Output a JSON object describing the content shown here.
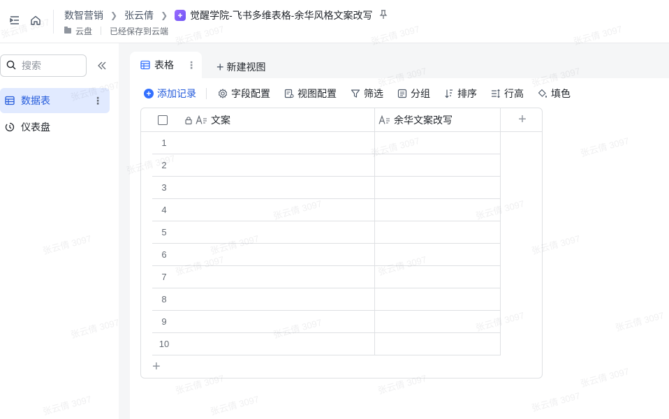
{
  "header": {
    "breadcrumbs": [
      "数智营销",
      "张云倩"
    ],
    "doc_title": "觉醒学院-飞书多维表格-余华风格文案改写",
    "location": "云盘",
    "save_status": "已经保存到云端"
  },
  "sidebar": {
    "search_placeholder": "搜索",
    "items": [
      {
        "label": "数据表",
        "icon": "table-icon",
        "active": true
      },
      {
        "label": "仪表盘",
        "icon": "dashboard-icon",
        "active": false
      }
    ]
  },
  "tabs": {
    "active_label": "表格",
    "new_view_label": "新建视图"
  },
  "toolbar": {
    "add_record": "添加记录",
    "field_config": "字段配置",
    "view_config": "视图配置",
    "filter": "筛选",
    "group": "分组",
    "sort": "排序",
    "row_height": "行高",
    "fill_color": "填色"
  },
  "table": {
    "columns": [
      {
        "name": "文案",
        "type": "text",
        "locked": true
      },
      {
        "name": "余华文案改写",
        "type": "text",
        "locked": false
      }
    ],
    "rows": [
      "1",
      "2",
      "3",
      "4",
      "5",
      "6",
      "7",
      "8",
      "9",
      "10"
    ]
  },
  "watermark": "张云倩 3097",
  "colors": {
    "accent": "#3370ff",
    "active_bg": "#e1eaff",
    "border": "#dee0e3"
  }
}
